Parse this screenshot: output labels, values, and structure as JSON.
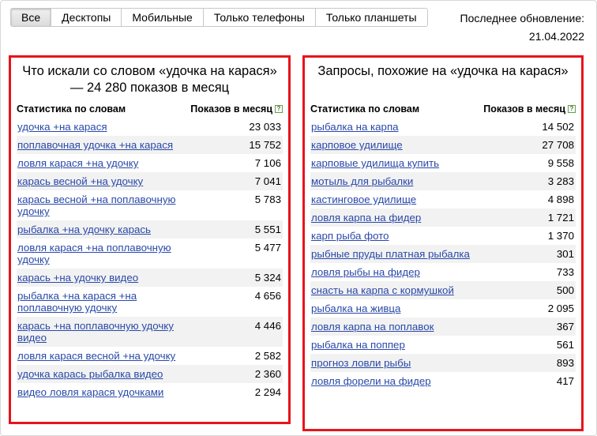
{
  "tabs": [
    {
      "label": "Все",
      "active": true
    },
    {
      "label": "Десктопы",
      "active": false
    },
    {
      "label": "Мобильные",
      "active": false
    },
    {
      "label": "Только телефоны",
      "active": false
    },
    {
      "label": "Только планшеты",
      "active": false
    }
  ],
  "updated": {
    "label": "Последнее обновление:",
    "date": "21.04.2022"
  },
  "colors": {
    "accent_border": "#e8141b",
    "link": "#2a49a8",
    "row_alt": "#f2f2f2"
  },
  "left": {
    "title": "Что искали со словом «удочка на карася» — 24 280 показов в месяц",
    "col1": "Статистика по словам",
    "col2": "Показов в месяц",
    "rows": [
      {
        "phrase": "удочка +на карася",
        "count": "23 033"
      },
      {
        "phrase": "поплавочная удочка +на карася",
        "count": "15 752"
      },
      {
        "phrase": "ловля карася +на удочку",
        "count": "7 106"
      },
      {
        "phrase": "карась весной +на удочку",
        "count": "7 041"
      },
      {
        "phrase": "карась весной +на поплавочную удочку",
        "count": "5 783"
      },
      {
        "phrase": "рыбалка +на удочку карась",
        "count": "5 551"
      },
      {
        "phrase": "ловля карася +на поплавочную удочку",
        "count": "5 477"
      },
      {
        "phrase": "карась +на удочку видео",
        "count": "5 324"
      },
      {
        "phrase": "рыбалка +на карася +на поплавочную удочку",
        "count": "4 656"
      },
      {
        "phrase": "карась +на поплавочную удочку видео",
        "count": "4 446"
      },
      {
        "phrase": "ловля карася весной +на удочку",
        "count": "2 582"
      },
      {
        "phrase": "удочка карась рыбалка видео",
        "count": "2 360"
      },
      {
        "phrase": "видео ловля карася удочками",
        "count": "2 294"
      }
    ]
  },
  "right": {
    "title": "Запросы, похожие на «удочка на карася»",
    "col1": "Статистика по словам",
    "col2": "Показов в месяц",
    "rows": [
      {
        "phrase": "рыбалка на карпа",
        "count": "14 502"
      },
      {
        "phrase": "карповое удилище",
        "count": "27 708"
      },
      {
        "phrase": "карповые удилища купить",
        "count": "9 558"
      },
      {
        "phrase": "мотыль для рыбалки",
        "count": "3 283"
      },
      {
        "phrase": "кастинговое удилище",
        "count": "4 898"
      },
      {
        "phrase": "ловля карпа на фидер",
        "count": "1 721"
      },
      {
        "phrase": "карп рыба фото",
        "count": "1 370"
      },
      {
        "phrase": "рыбные пруды платная рыбалка",
        "count": "301"
      },
      {
        "phrase": "ловля рыбы на фидер",
        "count": "733"
      },
      {
        "phrase": "снасть на карпа с кормушкой",
        "count": "500"
      },
      {
        "phrase": "рыбалка на живца",
        "count": "2 095"
      },
      {
        "phrase": "ловля карпа на поплавок",
        "count": "367"
      },
      {
        "phrase": "рыбалка на поппер",
        "count": "561"
      },
      {
        "phrase": "прогноз ловли рыбы",
        "count": "893"
      },
      {
        "phrase": "ловля форели на фидер",
        "count": "417"
      }
    ]
  }
}
